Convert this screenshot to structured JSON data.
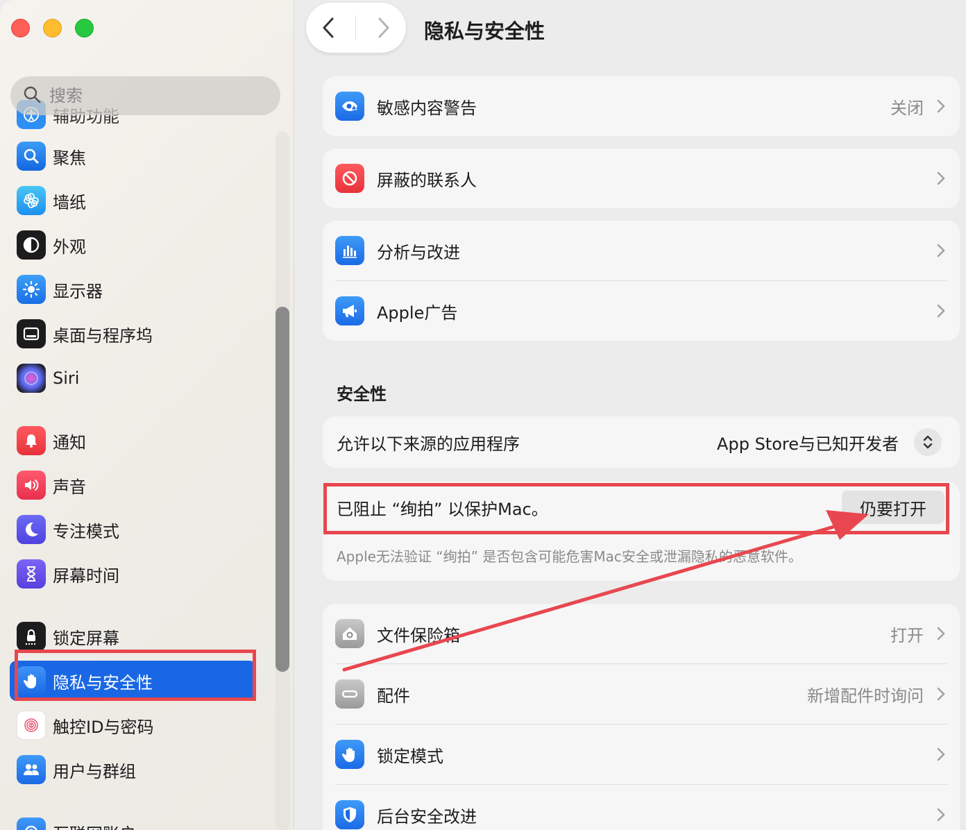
{
  "colors": {
    "accent": "#1967e4",
    "highlight_red": "#e8474f",
    "secondary_text": "#8a8a8a"
  },
  "window": {
    "traffic_lights": [
      "close",
      "minimize",
      "zoom"
    ]
  },
  "search": {
    "placeholder": "搜索"
  },
  "sidebar": {
    "items": [
      {
        "label": "辅助功能",
        "icon": "accessibility-icon"
      },
      {
        "label": "聚焦",
        "icon": "spotlight-icon"
      },
      {
        "label": "墙纸",
        "icon": "wallpaper-icon"
      },
      {
        "label": "外观",
        "icon": "appearance-icon"
      },
      {
        "label": "显示器",
        "icon": "display-icon"
      },
      {
        "label": "桌面与程序坞",
        "icon": "dock-icon"
      },
      {
        "label": "Siri",
        "icon": "siri-icon"
      },
      {
        "label": "通知",
        "icon": "notifications-icon"
      },
      {
        "label": "声音",
        "icon": "sound-icon"
      },
      {
        "label": "专注模式",
        "icon": "focus-icon"
      },
      {
        "label": "屏幕时间",
        "icon": "screen-time-icon"
      },
      {
        "label": "锁定屏幕",
        "icon": "lock-screen-icon"
      },
      {
        "label": "隐私与安全性",
        "icon": "hand-icon",
        "selected": true
      },
      {
        "label": "触控ID与密码",
        "icon": "fingerprint-icon"
      },
      {
        "label": "用户与群组",
        "icon": "users-icon"
      },
      {
        "label": "互联网账户",
        "icon": "internet-accounts-icon"
      }
    ]
  },
  "header": {
    "title": "隐私与安全性"
  },
  "privacy": {
    "sensitive": {
      "label": "敏感内容警告",
      "value": "关闭"
    },
    "blocked_contacts": {
      "label": "屏蔽的联系人"
    },
    "analytics": {
      "label": "分析与改进"
    },
    "apple_ads": {
      "label": "Apple广告"
    }
  },
  "security": {
    "title": "安全性",
    "allow_label": "允许以下来源的应用程序",
    "allow_value": "App Store与已知开发者",
    "blocked_text": "已阻止 “绚拍” 以保护Mac。",
    "open_anyway": "仍要打开",
    "note": "Apple无法验证 “绚拍” 是否包含可能危害Mac安全或泄漏隐私的恶意软件。",
    "filevault": {
      "label": "文件保险箱",
      "value": "打开"
    },
    "accessories": {
      "label": "配件",
      "value": "新增配件时询问"
    },
    "lockdown": {
      "label": "锁定模式"
    },
    "background": {
      "label": "后台安全改进"
    }
  }
}
